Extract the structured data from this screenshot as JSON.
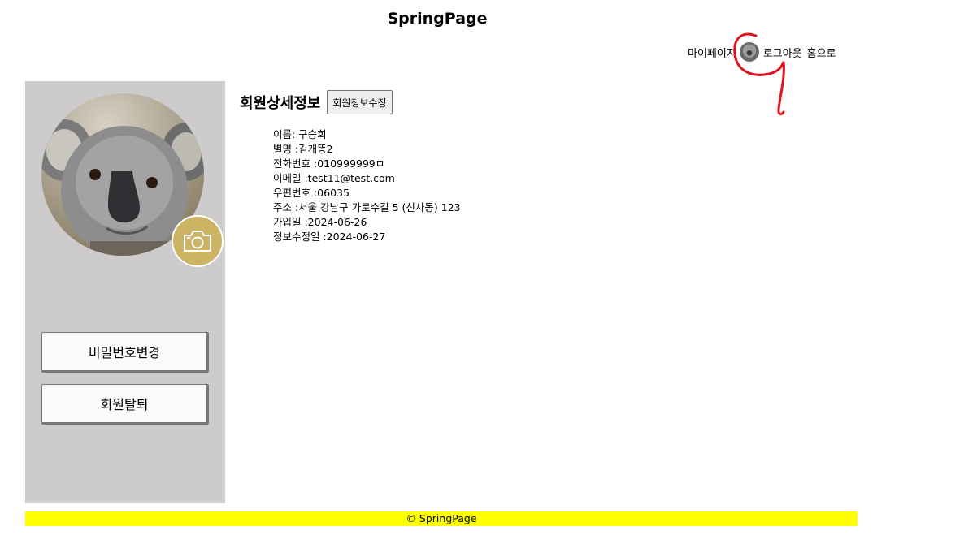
{
  "header": {
    "site_title": "SpringPage"
  },
  "nav": {
    "mypage": "마이페이지",
    "logout": "로그아웃",
    "home": "홈으로"
  },
  "sidebar": {
    "change_password": "비밀번호변경",
    "withdraw": "회원탈퇴"
  },
  "main": {
    "title": "회원상세정보",
    "edit_button": "회원정보수정",
    "fields": [
      {
        "text": "이름: 구승회"
      },
      {
        "text": "별명 :김개똥2"
      },
      {
        "text": "전화번호 :010999999ㅁ"
      },
      {
        "text": "이메일 :test11@test.com"
      },
      {
        "text": "우편번호 :06035"
      },
      {
        "text": "주소 :서울 강남구 가로수길 5 (신사동) 123"
      },
      {
        "text": "가입일 :2024-06-26"
      },
      {
        "text": "정보수정일 :2024-06-27"
      }
    ]
  },
  "footer": {
    "text": "© SpringPage"
  },
  "colors": {
    "sidebar_bg": "#cdcbcb",
    "footer_bg": "#ffff00",
    "camera_bg": "#cdb465",
    "annotation": "#e0141e"
  },
  "icons": {
    "profile": "koala-avatar",
    "camera": "camera-icon"
  }
}
